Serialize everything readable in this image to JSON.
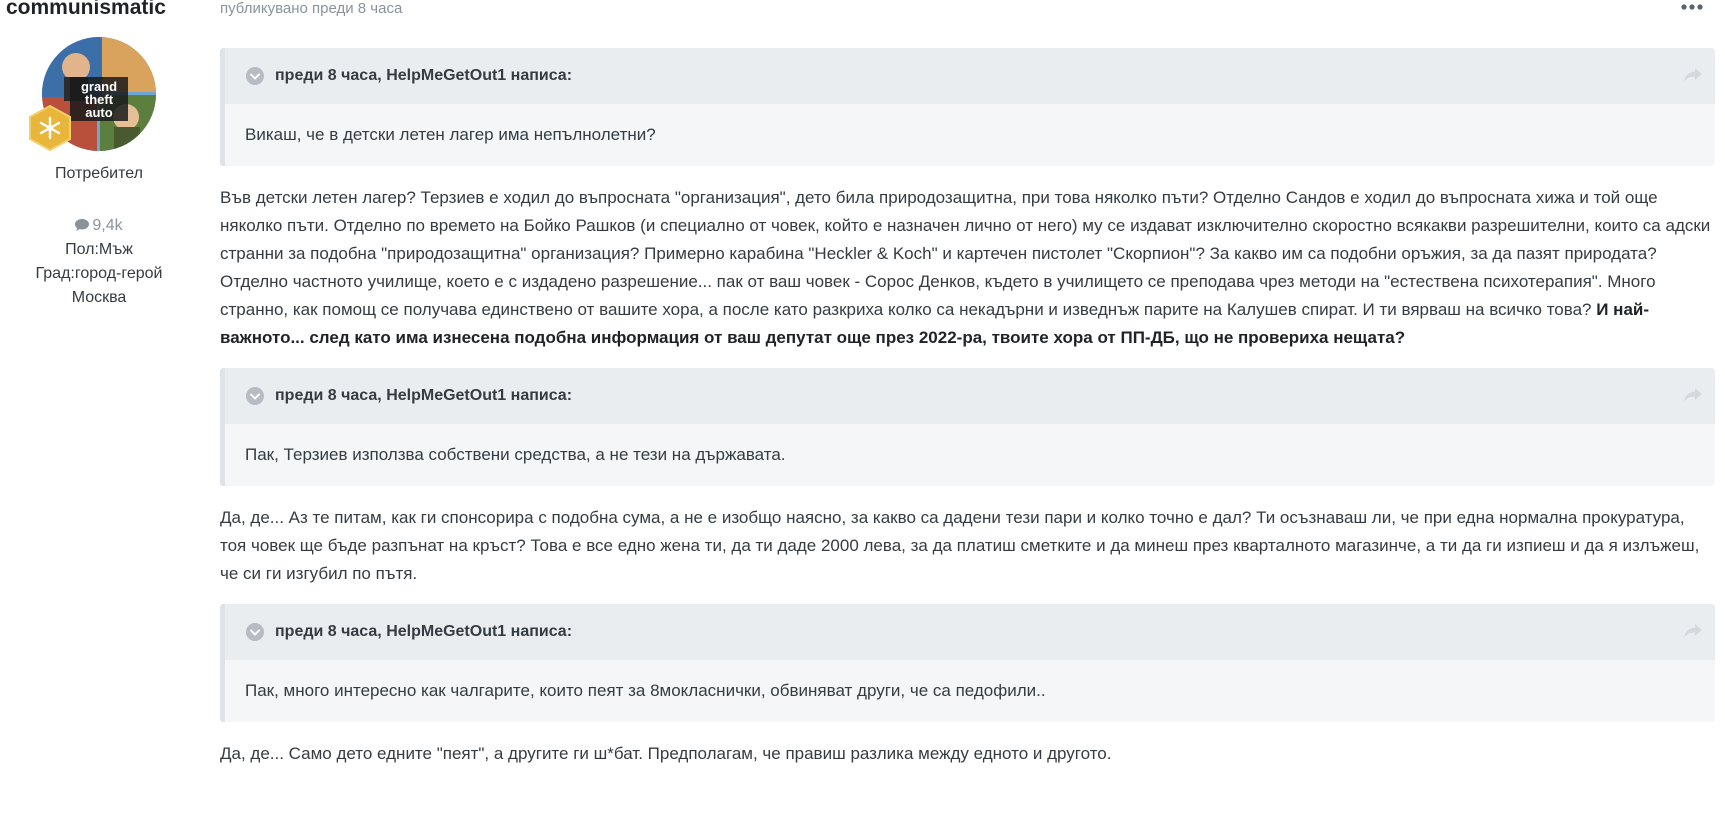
{
  "author": {
    "name": "communismatic",
    "group": "Потребител",
    "post_count": "9,4k",
    "gender": "Пол:Мъж",
    "city_line1": "Град:город-герой",
    "city_line2": "Москва",
    "avatar_text": [
      "grand",
      "theft",
      "auto"
    ]
  },
  "post": {
    "meta": "публикувано преди 8 часа",
    "paragraph1": "Във детски летен лагер? Терзиев е ходил до въпросната \"организация\", дето била природозащитна, при това няколко пъти? Отделно Сандов е ходил до въпросната хижа и той още няколко пъти. Отделно по времето на Бойко Рашков (и специално от човек, който е назначен лично от него) му се издават изключително скоростно всякакви разрешителни, които са адски странни за подобна \"природозащитна\" организация? Примерно карабина \"Heckler & Koch\" и картечен пистолет \"Скорпион\"? За какво им са подобни оръжия, за да пазят природата? Отделно частното училище, което е с издадено разрешение... пак от ваш човек - Сорос Денков, където в училището се преподава чрез методи на \"естествена психотерапия\". Много странно, как помощ се получава единствено от вашите хора, а после като разкриха колко са некадърни и изведнъж парите на Калушев спират. И ти вярваш на всичко това? ",
    "paragraph1_bold": "И най-важното... след като има изнесена подобна информация от ваш депутат още през 2022-ра, твоите хора от ПП-ДБ, що не провериха нещата?",
    "paragraph2": "Да, де... Аз те питам, как ги спонсорира с подобна сума, а не е изобщо наясно, за какво са дадени тези пари и колко точно е дал? Ти осъзнаваш ли, че при една нормална прокуратура, тоя човек ще бъде разпънат на кръст? Това е все едно жена ти, да ти даде 2000 лева, за да платиш сметките и да минеш през кварталното магазинче, а ти да ги изпиеш и да я излъжеш, че си ги изгубил по пътя.",
    "paragraph3": "Да, де... Само дето едните \"пеят\", а другите ги ш*бат. Предполагам, че правиш разлика между едното и другото."
  },
  "quotes": [
    {
      "header": "преди 8 часа, HelpMeGetOut1 написа:",
      "body": "Викаш, че в детски летен лагер има непълнолетни?"
    },
    {
      "header": "преди 8 часа, HelpMeGetOut1 написа:",
      "body": "Пак, Терзиев използва собствени средства, а не тези на държавата."
    },
    {
      "header": "преди 8 часа, HelpMeGetOut1 написа:",
      "body": "Пак, много интересно как чалгарите, които пеят за 8мокласнички, обвиняват други, че са педофили.."
    }
  ],
  "colors": {
    "rank_badge": "#e8b63a",
    "quote_bg": "#f4f6f8",
    "quote_head_bg": "#eaedf0",
    "muted_text": "#8a939c"
  },
  "icons": {
    "more": "ellipsis-icon",
    "quote_toggle": "chevron-down-circle-icon",
    "quote_share": "share-arrow-icon",
    "post_count": "comment-icon",
    "rank": "rank-badge-icon"
  }
}
